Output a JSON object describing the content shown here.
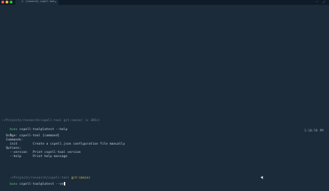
{
  "tab": {
    "title": "1: [research] cspell-tool",
    "close_glyph": "×",
    "menu_glyph": "⋯",
    "expand_glyph": "⤢"
  },
  "colors": {
    "background": "#1b2b3a",
    "text": "#c6d0da",
    "dim": "#6f8294",
    "green": "#5fc67e",
    "yellow": "#d9c46a"
  },
  "terminal": {
    "prev_path": "~/Projects/research/cspell-tool git:(main) (x 305s)",
    "prompt_user": "bunx",
    "prev_command": "cspell-tool@latest --help",
    "prompt_symbol": "$",
    "timestamp": "1:10:58 PM",
    "output": [
      "  Usage: cspell-tool [command]",
      "  Commands:",
      "    init        Create a cspell.json configuration file manually",
      "  Options:",
      "    --version   Print cspell-tool version",
      "    --help      Print help message"
    ],
    "cur_path": "~/Projects/research/cspell-tool",
    "cur_git": "git:(main)",
    "cur_command": "cspell-tool@latest --ve"
  }
}
